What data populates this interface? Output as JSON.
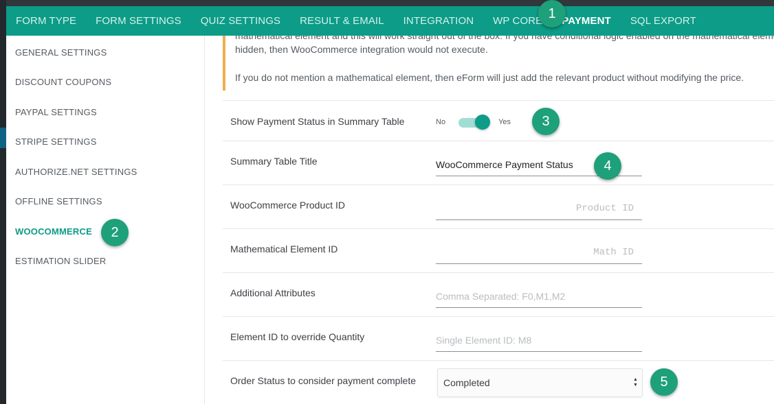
{
  "tabs": [
    {
      "label": "FORM TYPE",
      "active": false
    },
    {
      "label": "FORM SETTINGS",
      "active": false
    },
    {
      "label": "QUIZ SETTINGS",
      "active": false
    },
    {
      "label": "RESULT & EMAIL",
      "active": false
    },
    {
      "label": "INTEGRATION",
      "active": false
    },
    {
      "label": "WP CORE",
      "active": false
    },
    {
      "label": "PAYMENT",
      "active": true
    },
    {
      "label": "SQL EXPORT",
      "active": false
    }
  ],
  "sidebar": {
    "items": [
      {
        "label": "GENERAL SETTINGS",
        "active": false
      },
      {
        "label": "DISCOUNT COUPONS",
        "active": false
      },
      {
        "label": "PAYPAL SETTINGS",
        "active": false
      },
      {
        "label": "STRIPE SETTINGS",
        "active": false
      },
      {
        "label": "AUTHORIZE.NET SETTINGS",
        "active": false
      },
      {
        "label": "OFFLINE SETTINGS",
        "active": false
      },
      {
        "label": "WOOCOMMERCE",
        "active": true
      },
      {
        "label": "ESTIMATION SLIDER",
        "active": false
      }
    ]
  },
  "notice": {
    "line1": "mathematical element and this will work straight out of the box. If you have conditional logic enabled on the mathematical element",
    "line2": "hidden, then WooCommerce integration would not execute.",
    "line3": "If you do not mention a mathematical element, then eForm will just add the relevant product without modifying the price."
  },
  "form": {
    "show_status": {
      "label": "Show Payment Status in Summary Table",
      "no": "No",
      "yes": "Yes",
      "enabled": true
    },
    "summary_title": {
      "label": "Summary Table Title",
      "value": "WooCommerce Payment Status"
    },
    "product_id": {
      "label": "WooCommerce Product ID",
      "placeholder": "Product ID"
    },
    "math_id": {
      "label": "Mathematical Element ID",
      "placeholder": "Math ID"
    },
    "attributes": {
      "label": "Additional Attributes",
      "placeholder": "Comma Separated: F0,M1,M2"
    },
    "quantity": {
      "label": "Element ID to override Quantity",
      "placeholder": "Single Element ID: M8"
    },
    "order_status": {
      "label": "Order Status to consider payment complete",
      "value": "Completed"
    }
  },
  "markers": [
    "1",
    "2",
    "3",
    "4",
    "5"
  ],
  "colors": {
    "accent": "#0c9c87",
    "marker": "#1ea07a",
    "notice_border": "#f0ad4e"
  }
}
